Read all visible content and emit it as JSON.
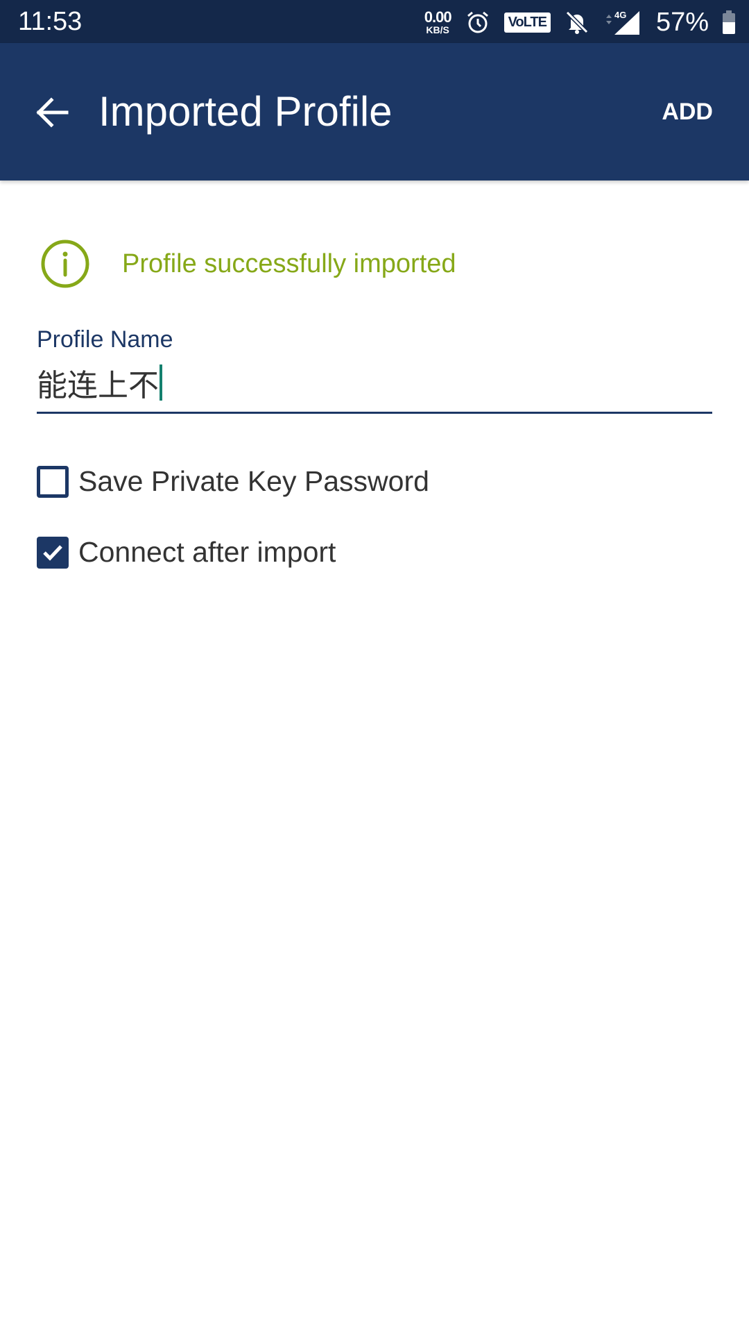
{
  "status_bar": {
    "time": "11:53",
    "net_speed_value": "0.00",
    "net_speed_unit": "KB/S",
    "volte_label": "VoLTE",
    "network_type": "4G",
    "battery_percent_text": "57%",
    "battery_level": 0.57,
    "icons": [
      "alarm-icon",
      "volte-icon",
      "bell-muted-icon",
      "data-arrows-icon",
      "signal-icon",
      "battery-icon"
    ]
  },
  "app_bar": {
    "back_icon": "arrow-left-icon",
    "title": "Imported Profile",
    "action_label": "ADD"
  },
  "info": {
    "icon": "info-circle-icon",
    "message": "Profile successfully imported",
    "color": "#86a818"
  },
  "profile_name": {
    "label": "Profile Name",
    "value": "能连上不"
  },
  "options": [
    {
      "label": "Save Private Key Password",
      "checked": false
    },
    {
      "label": "Connect after import",
      "checked": true
    }
  ],
  "colors": {
    "primary": "#1c3765",
    "status_bar": "#14284a",
    "success": "#86a818",
    "caret": "#14806e"
  }
}
